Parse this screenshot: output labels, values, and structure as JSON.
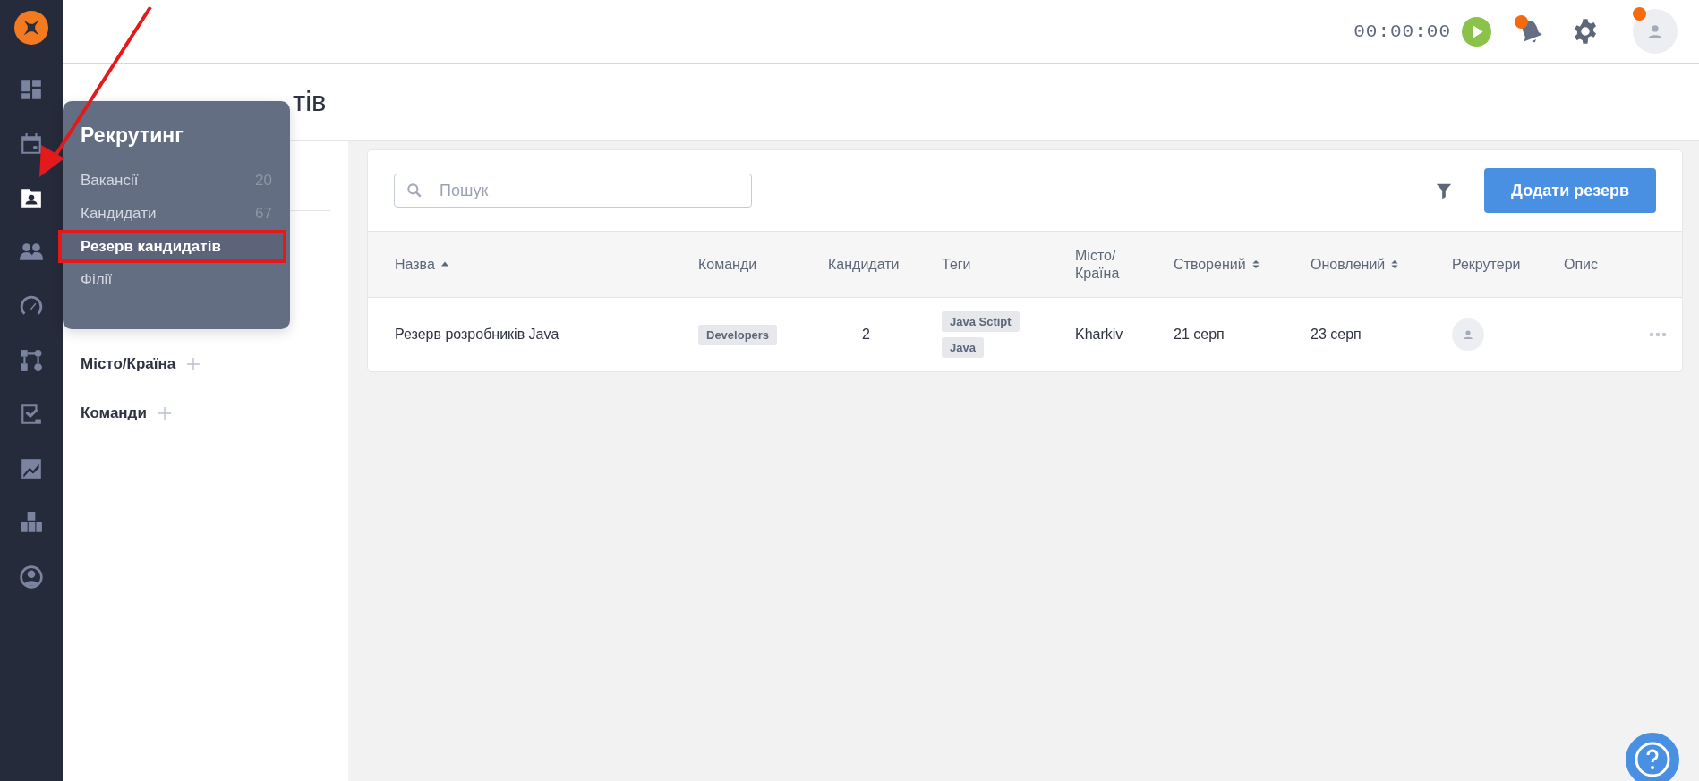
{
  "sidebar": {
    "items": [
      {
        "kind": "dashboard",
        "selected": false
      },
      {
        "kind": "calendar",
        "selected": false
      },
      {
        "kind": "recruiting",
        "selected": true
      },
      {
        "kind": "team",
        "selected": false
      },
      {
        "kind": "gauge",
        "selected": false
      },
      {
        "kind": "workflow",
        "selected": false
      },
      {
        "kind": "tasks",
        "selected": false
      },
      {
        "kind": "reports",
        "selected": false
      },
      {
        "kind": "boxes",
        "selected": false
      },
      {
        "kind": "profile",
        "selected": false
      }
    ]
  },
  "topbar": {
    "timer": "00:00:00",
    "notifications_badge": true,
    "avatar_badge": true
  },
  "page_title": "тів",
  "popover": {
    "title": "Рекрутинг",
    "items": [
      {
        "label": "Вакансії",
        "count": "20",
        "selected": false
      },
      {
        "label": "Кандидати",
        "count": "67",
        "selected": false
      },
      {
        "label": "Резерв кандидатів",
        "selected": true
      },
      {
        "label": "Філії",
        "selected": false
      }
    ]
  },
  "filters": [
    {
      "label": "Місто/Країна"
    },
    {
      "label": "Команди"
    }
  ],
  "search": {
    "placeholder": "Пошук"
  },
  "add_button": "Додати резерв",
  "table": {
    "columns": [
      {
        "label": "Назва",
        "sorted": true,
        "sortable": false
      },
      {
        "label": "Команди",
        "sorted": false,
        "sortable": false
      },
      {
        "label": "Кандидати",
        "sorted": false,
        "sortable": false
      },
      {
        "label": "Теги",
        "sorted": false,
        "sortable": false
      },
      {
        "label": "Місто/ Країна",
        "sorted": false,
        "sortable": false
      },
      {
        "label": "Створений",
        "sorted": false,
        "sortable": true
      },
      {
        "label": "Оновлений",
        "sorted": false,
        "sortable": true
      },
      {
        "label": "Рекрутери",
        "sorted": false,
        "sortable": false
      },
      {
        "label": "Опис",
        "sorted": false,
        "sortable": false
      }
    ],
    "rows": [
      {
        "name": "Резерв розробників Java",
        "teams": [
          "Developers"
        ],
        "candidates": "2",
        "tags": [
          "Java Sctipt",
          "Java"
        ],
        "city": "Kharkiv",
        "created": "21 серп",
        "updated": "23 серп"
      }
    ]
  }
}
